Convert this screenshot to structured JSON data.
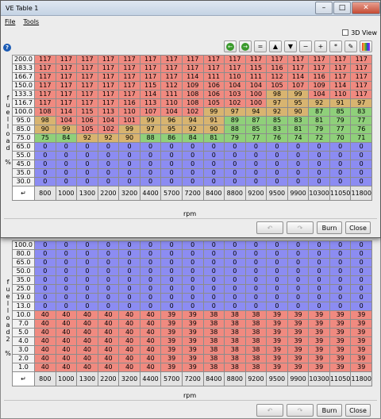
{
  "front": {
    "title": "VE Table 1",
    "menu": [
      "File",
      "Tools"
    ],
    "view3d_label": "3D View",
    "y_axis_label": "fuelload",
    "y_axis_unit": "%",
    "x_axis_label": "rpm",
    "rpm": [
      "800",
      "1000",
      "1300",
      "2200",
      "3200",
      "4400",
      "5700",
      "7200",
      "8400",
      "8800",
      "9200",
      "9500",
      "9900",
      "10300",
      "11050",
      "11800"
    ],
    "load": [
      "200.0",
      "183.3",
      "166.7",
      "150.0",
      "133.3",
      "116.7",
      "100.0",
      "95.0",
      "85.0",
      "75.0",
      "65.0",
      "55.0",
      "45.0",
      "35.0",
      "30.0"
    ],
    "rows": [
      [
        "117",
        "117",
        "117",
        "117",
        "117",
        "117",
        "117",
        "117",
        "117",
        "117",
        "117",
        "117",
        "117",
        "117",
        "117",
        "117"
      ],
      [
        "117",
        "117",
        "117",
        "117",
        "117",
        "117",
        "117",
        "117",
        "117",
        "117",
        "115",
        "116",
        "117",
        "117",
        "117",
        "117"
      ],
      [
        "117",
        "117",
        "117",
        "117",
        "117",
        "117",
        "117",
        "114",
        "111",
        "110",
        "111",
        "112",
        "114",
        "116",
        "117",
        "117"
      ],
      [
        "117",
        "117",
        "117",
        "117",
        "117",
        "115",
        "112",
        "109",
        "106",
        "104",
        "104",
        "105",
        "107",
        "109",
        "114",
        "117"
      ],
      [
        "117",
        "117",
        "117",
        "117",
        "117",
        "114",
        "111",
        "108",
        "106",
        "103",
        "100",
        "98",
        "99",
        "104",
        "110",
        "117"
      ],
      [
        "117",
        "117",
        "117",
        "117",
        "116",
        "113",
        "110",
        "108",
        "105",
        "102",
        "100",
        "97",
        "95",
        "92",
        "91",
        "97"
      ],
      [
        "108",
        "114",
        "115",
        "113",
        "110",
        "107",
        "104",
        "102",
        "99",
        "97",
        "94",
        "92",
        "90",
        "87",
        "85",
        "83"
      ],
      [
        "98",
        "104",
        "106",
        "104",
        "101",
        "99",
        "96",
        "94",
        "91",
        "89",
        "87",
        "85",
        "83",
        "81",
        "79",
        "77"
      ],
      [
        "90",
        "99",
        "105",
        "102",
        "99",
        "97",
        "95",
        "92",
        "90",
        "88",
        "85",
        "83",
        "81",
        "79",
        "77",
        "76"
      ],
      [
        "75",
        "84",
        "92",
        "92",
        "90",
        "88",
        "86",
        "84",
        "81",
        "79",
        "77",
        "76",
        "74",
        "72",
        "70",
        "71"
      ],
      [
        "0",
        "0",
        "0",
        "0",
        "0",
        "0",
        "0",
        "0",
        "0",
        "0",
        "0",
        "0",
        "0",
        "0",
        "0",
        "0"
      ],
      [
        "0",
        "0",
        "0",
        "0",
        "0",
        "0",
        "0",
        "0",
        "0",
        "0",
        "0",
        "0",
        "0",
        "0",
        "0",
        "0"
      ],
      [
        "0",
        "0",
        "0",
        "0",
        "0",
        "0",
        "0",
        "0",
        "0",
        "0",
        "0",
        "0",
        "0",
        "0",
        "0",
        "0"
      ],
      [
        "0",
        "0",
        "0",
        "0",
        "0",
        "0",
        "0",
        "0",
        "0",
        "0",
        "0",
        "0",
        "0",
        "0",
        "0",
        "0"
      ],
      [
        "0",
        "0",
        "0",
        "0",
        "0",
        "0",
        "0",
        "0",
        "0",
        "0",
        "0",
        "0",
        "0",
        "0",
        "0",
        "0"
      ]
    ],
    "burn_label": "Burn",
    "close_label": "Close"
  },
  "back": {
    "y_axis_label": "fuelload2",
    "y_axis_unit": "%",
    "x_axis_label": "rpm",
    "load": [
      "100.0",
      "80.0",
      "65.0",
      "50.0",
      "35.0",
      "25.0",
      "19.0",
      "13.0",
      "10.0",
      "7.0",
      "5.0",
      "4.0",
      "3.0",
      "2.0",
      "1.0"
    ],
    "rows": [
      [
        "0",
        "0",
        "0",
        "0",
        "0",
        "0",
        "0",
        "0",
        "0",
        "0",
        "0",
        "0",
        "0",
        "0",
        "0",
        "0"
      ],
      [
        "0",
        "0",
        "0",
        "0",
        "0",
        "0",
        "0",
        "0",
        "0",
        "0",
        "0",
        "0",
        "0",
        "0",
        "0",
        "0"
      ],
      [
        "0",
        "0",
        "0",
        "0",
        "0",
        "0",
        "0",
        "0",
        "0",
        "0",
        "0",
        "0",
        "0",
        "0",
        "0",
        "0"
      ],
      [
        "0",
        "0",
        "0",
        "0",
        "0",
        "0",
        "0",
        "0",
        "0",
        "0",
        "0",
        "0",
        "0",
        "0",
        "0",
        "0"
      ],
      [
        "0",
        "0",
        "0",
        "0",
        "0",
        "0",
        "0",
        "0",
        "0",
        "0",
        "0",
        "0",
        "0",
        "0",
        "0",
        "0"
      ],
      [
        "0",
        "0",
        "0",
        "0",
        "0",
        "0",
        "0",
        "0",
        "0",
        "0",
        "0",
        "0",
        "0",
        "0",
        "0",
        "0"
      ],
      [
        "0",
        "0",
        "0",
        "0",
        "0",
        "0",
        "0",
        "0",
        "0",
        "0",
        "0",
        "0",
        "0",
        "0",
        "0",
        "0"
      ],
      [
        "0",
        "0",
        "0",
        "0",
        "0",
        "0",
        "0",
        "0",
        "0",
        "0",
        "0",
        "0",
        "0",
        "0",
        "0",
        "0"
      ],
      [
        "40",
        "40",
        "40",
        "40",
        "40",
        "40",
        "39",
        "39",
        "38",
        "38",
        "38",
        "39",
        "39",
        "39",
        "39",
        "39"
      ],
      [
        "40",
        "40",
        "40",
        "40",
        "40",
        "40",
        "39",
        "39",
        "38",
        "38",
        "38",
        "39",
        "39",
        "39",
        "39",
        "39"
      ],
      [
        "40",
        "40",
        "40",
        "40",
        "40",
        "40",
        "39",
        "39",
        "38",
        "38",
        "38",
        "39",
        "39",
        "39",
        "39",
        "39"
      ],
      [
        "40",
        "40",
        "40",
        "40",
        "40",
        "40",
        "39",
        "39",
        "38",
        "38",
        "38",
        "39",
        "39",
        "39",
        "39",
        "39"
      ],
      [
        "40",
        "40",
        "40",
        "40",
        "40",
        "40",
        "39",
        "39",
        "38",
        "38",
        "38",
        "39",
        "39",
        "39",
        "39",
        "39"
      ],
      [
        "40",
        "40",
        "40",
        "40",
        "40",
        "40",
        "39",
        "39",
        "38",
        "38",
        "38",
        "39",
        "39",
        "39",
        "39",
        "39"
      ],
      [
        "40",
        "40",
        "40",
        "40",
        "40",
        "40",
        "39",
        "39",
        "38",
        "38",
        "38",
        "39",
        "39",
        "39",
        "39",
        "39"
      ]
    ],
    "burn_label": "Burn",
    "close_label": "Close"
  },
  "colors": {
    "red": "#f08a80",
    "yellow": "#d8b470",
    "green": "#8fd07a",
    "blue": "#8c8cf2"
  }
}
